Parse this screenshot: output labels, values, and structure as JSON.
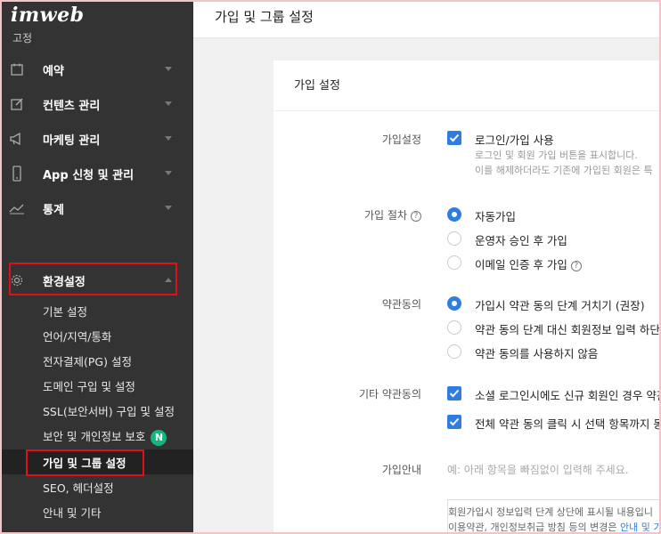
{
  "app": {
    "logo": "imweb"
  },
  "sidebar": {
    "cut_item": "고정",
    "items": [
      {
        "label": "예약",
        "icon": "calendar-icon"
      },
      {
        "label": "컨텐츠 관리",
        "icon": "edit-icon"
      },
      {
        "label": "마케팅 관리",
        "icon": "megaphone-icon"
      },
      {
        "label": "App 신청 및 관리",
        "icon": "mobile-icon"
      },
      {
        "label": "통계",
        "icon": "chart-icon"
      },
      {
        "label": "환경설정",
        "icon": "gear-icon"
      }
    ],
    "subitems": [
      "기본 설정",
      "언어/지역/통화",
      "전자결제(PG) 설정",
      "도메인 구입 및 설정",
      "SSL(보안서버) 구입 및 설정",
      "보안 및 개인정보 보호",
      "가입 및 그룹 설정",
      "SEO, 헤더설정",
      "안내 및 기타"
    ],
    "badge": "N"
  },
  "header": {
    "title": "가입 및 그룹 설정"
  },
  "card": {
    "title": "가입 설정",
    "signup": {
      "label": "가입설정",
      "option": "로그인/가입 사용",
      "desc1": "로그인 및 회원 가입 버튼을 표시합니다.",
      "desc2": "이를 해제하더라도 기존에 가입된 회원은 특"
    },
    "process": {
      "label": "가입 절차",
      "options": [
        "자동가입",
        "운영자 승인 후 가입",
        "이메일 인증 후 가입"
      ]
    },
    "terms": {
      "label": "약관동의",
      "options": [
        "가입시 약관 동의 단계 거치기 (권장)",
        "약관 동의 단계 대신 회원정보 입력 하단에",
        "약관 동의를 사용하지 않음"
      ]
    },
    "other_terms": {
      "label": "기타 약관동의",
      "options": [
        "소셜 로그인시에도 신규 회원인 경우 약관",
        "전체 약관 동의 클릭 시 선택 항목까지 동"
      ]
    },
    "guide": {
      "label": "가입안내",
      "placeholder": "예: 아래 항목을 빠짐없이 입력해 주세요.",
      "notice1": "회원가입시 정보입력 단계 상단에 표시될 내용입니",
      "notice2_prefix": "이용약관, 개인정보취급 방침 등의 변경은 ",
      "notice2_link": "안내 및 기"
    }
  },
  "colors": {
    "accent": "#2f7de1",
    "sidebar_bg": "#333333",
    "highlight_box": "#e0101a",
    "badge": "#16b57f"
  }
}
